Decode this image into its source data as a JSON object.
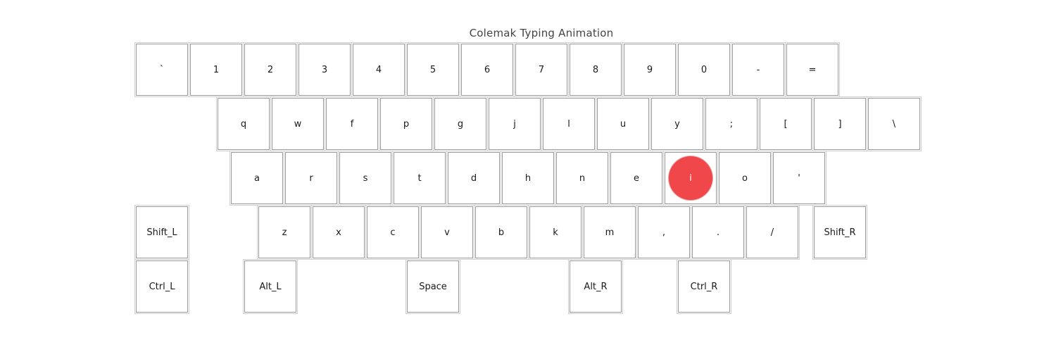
{
  "title": "Colemak Typing Animation",
  "highlight_color": "#f0474a",
  "highlighted_key": "i",
  "keys": {
    "row1": [
      "`",
      "1",
      "2",
      "3",
      "4",
      "5",
      "6",
      "7",
      "8",
      "9",
      "0",
      "-",
      "="
    ],
    "row2": [
      "q",
      "w",
      "f",
      "p",
      "g",
      "j",
      "l",
      "u",
      "y",
      ";",
      "[",
      "]",
      "\\"
    ],
    "row3": [
      "a",
      "r",
      "s",
      "t",
      "d",
      "h",
      "n",
      "e",
      "i",
      "o",
      "'"
    ],
    "shift_left": "Shift_L",
    "row4": [
      "z",
      "x",
      "c",
      "v",
      "b",
      "k",
      "m",
      ",",
      ".",
      "/"
    ],
    "shift_right": "Shift_R",
    "ctrl_left": "Ctrl_L",
    "alt_left": "Alt_L",
    "space": "Space",
    "alt_right": "Alt_R",
    "ctrl_right": "Ctrl_R"
  }
}
